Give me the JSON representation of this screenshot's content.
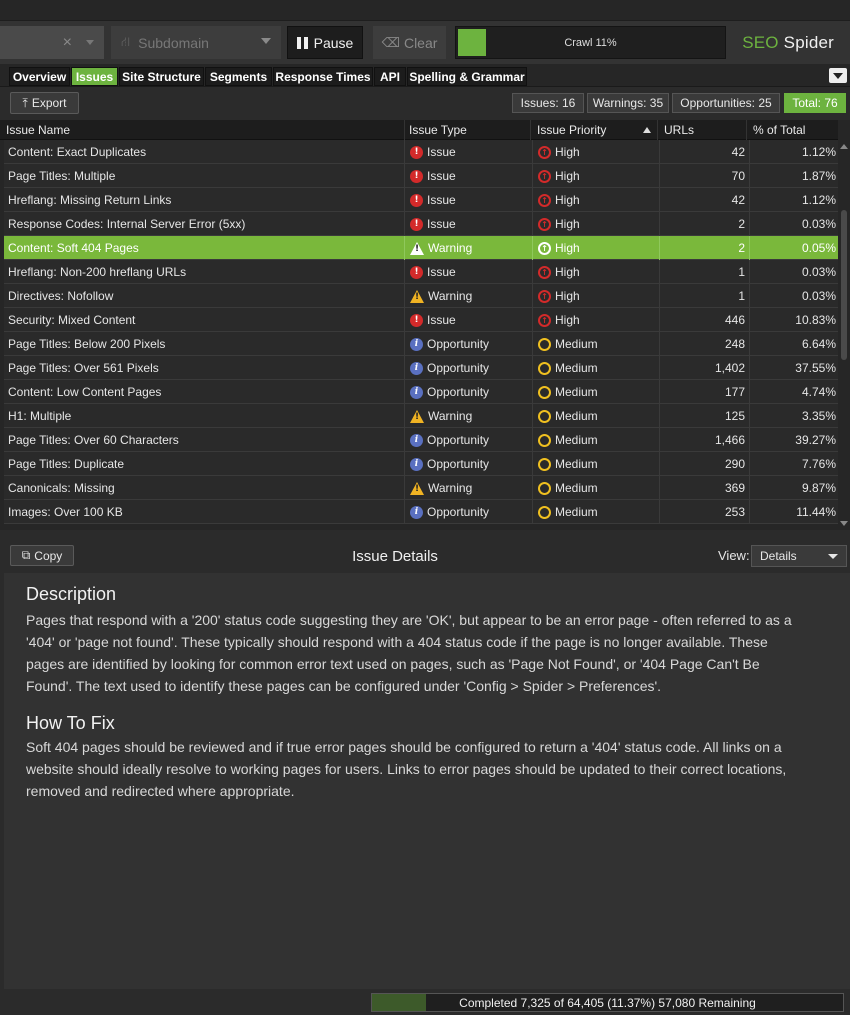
{
  "toolbar": {
    "url_close": "×",
    "subdomain_label": "Subdomain",
    "pause_label": "Pause",
    "clear_label": "Clear",
    "crawl_label": "Crawl 11%",
    "crawl_progress": 0.11,
    "brand_prefix": "SEO",
    "brand_name": "Spider"
  },
  "tabs": [
    "Overview",
    "Issues",
    "Site Structure",
    "Segments",
    "Response Times",
    "API",
    "Spelling & Grammar"
  ],
  "active_tab": "Issues",
  "actions": {
    "export_label": "Export",
    "counts": {
      "issues": "Issues: 16",
      "warnings": "Warnings: 35",
      "opportunities": "Opportunities: 25",
      "total": "Total: 76"
    }
  },
  "table": {
    "columns": [
      "Issue Name",
      "Issue Type",
      "Issue Priority",
      "URLs",
      "% of Total"
    ],
    "selected_row": 4,
    "rows": [
      {
        "name": "Content: Exact Duplicates",
        "type": "Issue",
        "priority": "High",
        "urls": "42",
        "pct": "1.12%"
      },
      {
        "name": "Page Titles: Multiple",
        "type": "Issue",
        "priority": "High",
        "urls": "70",
        "pct": "1.87%"
      },
      {
        "name": "Hreflang: Missing Return Links",
        "type": "Issue",
        "priority": "High",
        "urls": "42",
        "pct": "1.12%"
      },
      {
        "name": "Response Codes: Internal Server Error (5xx)",
        "type": "Issue",
        "priority": "High",
        "urls": "2",
        "pct": "0.03%"
      },
      {
        "name": "Content: Soft 404 Pages",
        "type": "Warning",
        "priority": "High",
        "urls": "2",
        "pct": "0.05%"
      },
      {
        "name": "Hreflang: Non-200 hreflang URLs",
        "type": "Issue",
        "priority": "High",
        "urls": "1",
        "pct": "0.03%"
      },
      {
        "name": "Directives: Nofollow",
        "type": "Warning",
        "priority": "High",
        "urls": "1",
        "pct": "0.03%"
      },
      {
        "name": "Security: Mixed Content",
        "type": "Issue",
        "priority": "High",
        "urls": "446",
        "pct": "10.83%"
      },
      {
        "name": "Page Titles: Below 200 Pixels",
        "type": "Opportunity",
        "priority": "Medium",
        "urls": "248",
        "pct": "6.64%"
      },
      {
        "name": "Page Titles: Over 561 Pixels",
        "type": "Opportunity",
        "priority": "Medium",
        "urls": "1,402",
        "pct": "37.55%"
      },
      {
        "name": "Content: Low Content Pages",
        "type": "Opportunity",
        "priority": "Medium",
        "urls": "177",
        "pct": "4.74%"
      },
      {
        "name": "H1: Multiple",
        "type": "Warning",
        "priority": "Medium",
        "urls": "125",
        "pct": "3.35%"
      },
      {
        "name": "Page Titles: Over 60 Characters",
        "type": "Opportunity",
        "priority": "Medium",
        "urls": "1,466",
        "pct": "39.27%"
      },
      {
        "name": "Page Titles: Duplicate",
        "type": "Opportunity",
        "priority": "Medium",
        "urls": "290",
        "pct": "7.76%"
      },
      {
        "name": "Canonicals: Missing",
        "type": "Warning",
        "priority": "Medium",
        "urls": "369",
        "pct": "9.87%"
      },
      {
        "name": "Images: Over 100 KB",
        "type": "Opportunity",
        "priority": "Medium",
        "urls": "253",
        "pct": "11.44%"
      }
    ]
  },
  "details": {
    "copy_label": "Copy",
    "title": "Issue Details",
    "view_label": "View:",
    "view_value": "Details",
    "description_heading": "Description",
    "description_text": "Pages that respond with a '200' status code suggesting they are 'OK', but appear to be an error page - often referred to as a '404' or 'page not found'. These typically should respond with a 404 status code if the page is no longer available. These pages are identified by looking for common error text used on pages, such as 'Page Not Found', or '404 Page Can't Be Found'. The text used to identify these pages can be configured under 'Config > Spider > Preferences'.",
    "fix_heading": "How To Fix",
    "fix_text": "Soft 404 pages should be reviewed and if true error pages should be configured to return a '404' status code. All links on a website should ideally resolve to working pages for users. Links to error pages should be updated to their correct locations, removed and redirected where appropriate."
  },
  "status": {
    "text": "Completed 7,325 of 64,405 (11.37%) 57,080 Remaining",
    "progress": 0.1137
  },
  "colors": {
    "accent": "#6db33f",
    "issue": "#d32a2a",
    "warning": "#f0b323",
    "opportunity": "#5a70c0",
    "medium": "#f0c020"
  }
}
